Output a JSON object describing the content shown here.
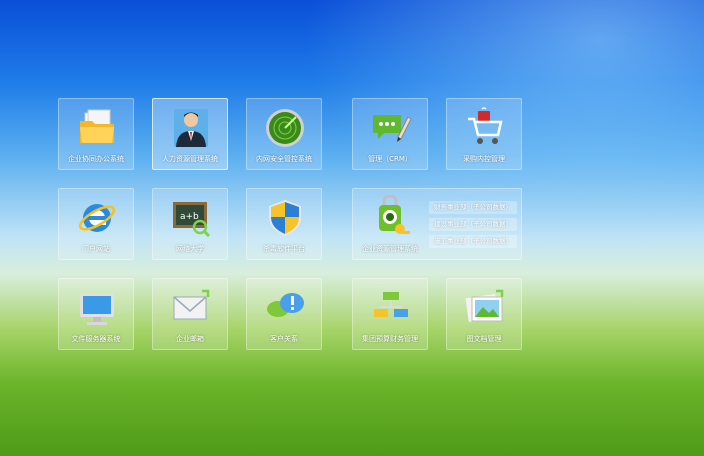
{
  "tiles": {
    "office": {
      "label": "企业协同办公系统",
      "icon": "folder-icon"
    },
    "hr": {
      "label": "人力资源管理系统",
      "icon": "business-person-icon"
    },
    "intranet": {
      "label": "内网安全管控系统",
      "icon": "radar-icon"
    },
    "crm": {
      "label": "管理（CRM）",
      "icon": "chat-pencil-icon"
    },
    "purchase": {
      "label": "采购内控管理",
      "icon": "shopping-cart-icon"
    },
    "portal": {
      "label": "门户网站",
      "icon": "internet-explorer-icon"
    },
    "university": {
      "label": "网络大学",
      "icon": "chalkboard-icon"
    },
    "antivirus": {
      "label": "杀毒软件平台",
      "icon": "shield-icon"
    },
    "erp": {
      "label": "企业资源管理系统",
      "icon": "key-lock-icon"
    },
    "fileserver": {
      "label": "文件服务器系统",
      "icon": "monitor-icon"
    },
    "mail": {
      "label": "企业邮箱",
      "icon": "envelope-icon"
    },
    "customer": {
      "label": "客户关系",
      "icon": "speech-bubbles-icon"
    },
    "finance": {
      "label": "集团预算财务管理",
      "icon": "org-chart-icon"
    },
    "gallery": {
      "label": "图文档管理",
      "icon": "picture-icon"
    }
  },
  "erp_subitems": [
    {
      "label": "财务事业部（子公司数据）"
    },
    {
      "label": "建设事业部（子公司数据）"
    },
    {
      "label": "施工事业部（子公司数据）"
    }
  ],
  "colors": {
    "tile_bg": "rgba(255,255,255,0.18)",
    "label": "#ffffff",
    "bg_top": "#0a4fd8",
    "bg_bottom": "#4f9a18"
  }
}
